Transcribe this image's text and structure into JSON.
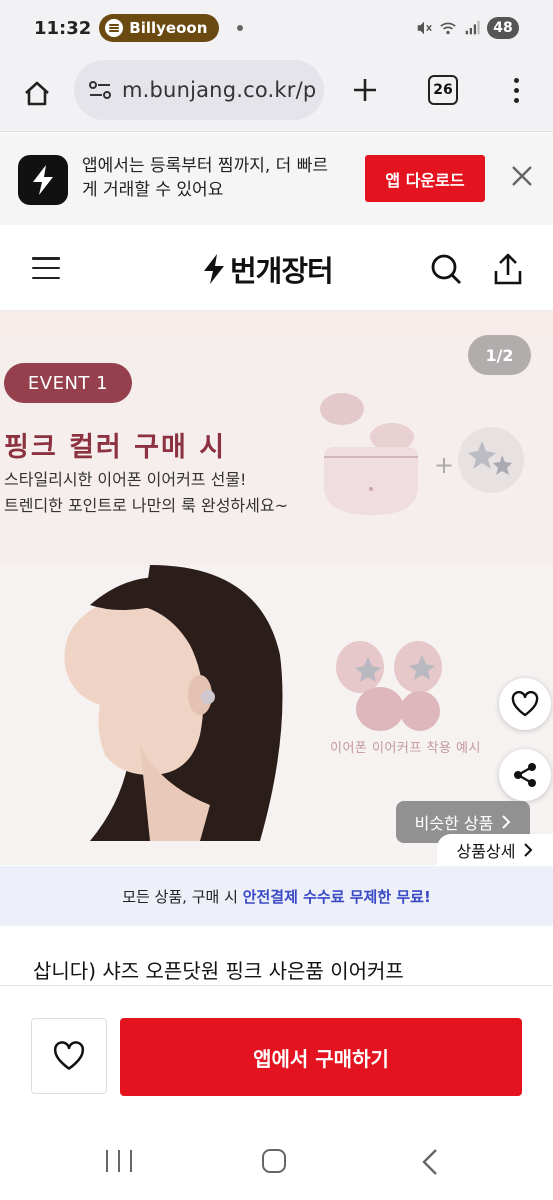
{
  "status_bar": {
    "time": "11:32",
    "media_app": "Billyeoon",
    "battery": "48"
  },
  "browser": {
    "url": "m.bunjang.co.kr/p",
    "tab_count": "26"
  },
  "app_banner": {
    "text": "앱에서는 등록부터 찜까지, 더 빠르게 거래할 수 있어요",
    "download_label": "앱 다운로드"
  },
  "header": {
    "brand": "번개장터"
  },
  "product_image": {
    "event_badge": "EVENT 1",
    "event_title": "핑크 컬러 구매 시",
    "event_desc_line1": "스타일리시한 이어폰 이어커프 선물!",
    "event_desc_line2": "트렌디한 포인트로 나만의 룩 완성하세요~",
    "cuff_caption": "이어폰 이어커프 착용 예시",
    "page_indicator": "1/2"
  },
  "similar_label": "비슷한 상품",
  "detail_label": "상품상세",
  "promo": {
    "prefix": "모든 상품, 구매 시 ",
    "highlight": "안전결제 수수료 무제한 무료!"
  },
  "product_title": "삽니다) 샤즈 오픈닷원 핑크 사은품 이어커프",
  "actions": {
    "buy_label": "앱에서 구매하기"
  },
  "colors": {
    "brand_red": "#e3141f",
    "event_accent": "#96404d",
    "promo_blue": "#3a49c6"
  }
}
